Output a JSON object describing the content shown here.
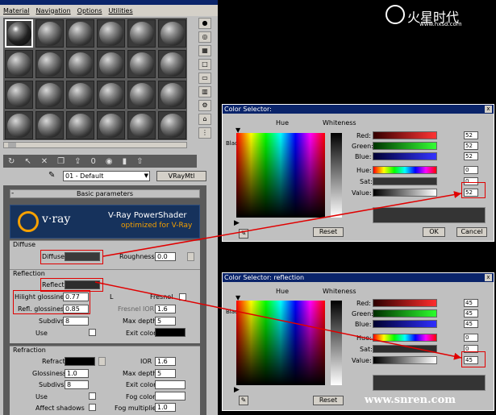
{
  "menu": [
    "Material",
    "Navigation",
    "Options",
    "Utilities"
  ],
  "toolbar_icons": [
    "rotate-icon",
    "cursor-icon",
    "delete-icon",
    "copy-icon",
    "assign-icon",
    "zero-icon",
    "world-icon",
    "highlight-icon",
    "nav-up-icon"
  ],
  "material": {
    "name": "01 - Default",
    "type": "VRayMtl"
  },
  "rollout": {
    "title": "Basic parameters",
    "minus": "-"
  },
  "vray_logo": {
    "brand": "v·ray",
    "title": "V-Ray PowerShader",
    "subtitle": "optimized for V-Ray"
  },
  "diffuse": {
    "group": "Diffuse",
    "diffuse_label": "Diffuse",
    "roughness_label": "Roughness",
    "roughness": "0.0"
  },
  "reflection": {
    "group": "Reflection",
    "reflect_label": "Reflect",
    "hilight_label": "Hilight glossiness",
    "hilight": "0.77",
    "lock": "L",
    "fresnel_label": "Fresnel",
    "refl_gloss_label": "Refl. glossiness",
    "refl_gloss": "0.85",
    "fresnel_ior_label": "Fresnel IOR",
    "fresnel_ior": "1.6",
    "subdivs_label": "Subdivs",
    "subdivs": "8",
    "max_depth_label": "Max depth",
    "max_depth": "5",
    "use_label": "Use",
    "exit_color_label": "Exit color"
  },
  "refraction": {
    "group": "Refraction",
    "refract_label": "Refract",
    "ior_label": "IOR",
    "ior": "1.6",
    "glossiness_label": "Glossiness",
    "glossiness": "1.0",
    "max_depth_label": "Max depth",
    "max_depth": "5",
    "subdivs_label": "Subdivs",
    "subdivs": "8",
    "exit_color_label": "Exit color",
    "use_label": "Use",
    "fog_color_label": "Fog color",
    "affect_shadows_label": "Affect shadows",
    "fog_mult_label": "Fog multiplier",
    "fog_mult": "1.0"
  },
  "cs1": {
    "title": "Color Selector:",
    "hue_label": "Hue",
    "whiteness_label": "Whiteness",
    "blackness_label": "Blackness",
    "red_label": "Red:",
    "red": "52",
    "green_label": "Green:",
    "green": "52",
    "blue_label": "Blue:",
    "blue": "52",
    "hue_val_label": "Hue:",
    "hue": "0",
    "sat_label": "Sat:",
    "sat": "0",
    "value_label": "Value:",
    "value": "52",
    "reset": "Reset",
    "ok": "OK",
    "cancel": "Cancel",
    "close": "x"
  },
  "cs2": {
    "title": "Color Selector: reflection",
    "hue_label": "Hue",
    "whiteness_label": "Whiteness",
    "blackness_label": "Blackness",
    "red_label": "Red:",
    "red": "45",
    "green_label": "Green:",
    "green": "45",
    "blue_label": "Blue:",
    "blue": "45",
    "hue_val_label": "Hue:",
    "hue": "0",
    "sat_label": "Sat:",
    "sat": "0",
    "value_label": "Value:",
    "value": "45",
    "reset": "Reset",
    "close": "x"
  },
  "branding": {
    "logo": "火星时代",
    "site": "www.hxsd.com",
    "watermark": "www.snren.com"
  },
  "colors": {
    "accent": "#e00000",
    "titlebar": "#0a246a",
    "vray_orange": "#f5a000"
  }
}
